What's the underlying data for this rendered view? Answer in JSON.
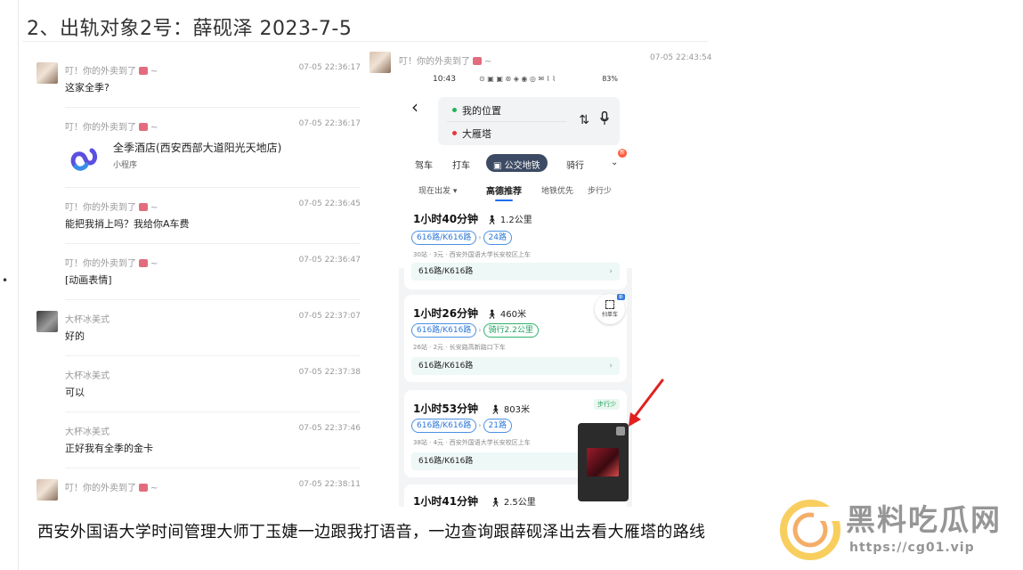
{
  "heading": "2、出轨对象2号：薛砚泽 2023-7-5",
  "bullet": "•",
  "chat": {
    "messages": [
      {
        "sender": "叮！你的外卖到了",
        "suffix": "~",
        "time": "07-05 22:36:17",
        "text": "这家全季?"
      },
      {
        "sender": "叮！你的外卖到了",
        "suffix": "~",
        "time": "07-05 22:36:17",
        "mini_program": {
          "title": "全季酒店(西安西部大道阳光天地店)",
          "sub": "小程序"
        }
      },
      {
        "sender": "叮！你的外卖到了",
        "suffix": "~",
        "time": "07-05 22:36:45",
        "text": "能把我捎上吗？我给你A车费"
      },
      {
        "sender": "叮！你的外卖到了",
        "suffix": "~",
        "time": "07-05 22:36:47",
        "text": "[动画表情]"
      },
      {
        "sender": "大杯冰美式",
        "time": "07-05 22:37:07",
        "text": "好的"
      },
      {
        "sender": "大杯冰美式",
        "time": "07-05 22:37:38",
        "text": "可以"
      },
      {
        "sender": "大杯冰美式",
        "time": "07-05 22:37:46",
        "text": "正好我有全季的金卡"
      },
      {
        "sender": "叮！你的外卖到了",
        "suffix": "~",
        "time": "07-05 22:38:11",
        "text": ""
      }
    ]
  },
  "right_header": {
    "sender": "叮！你的外卖到了",
    "suffix": "~",
    "time": "07-05 22:43:54"
  },
  "phone": {
    "clock": "10:43",
    "status_icons": "⊙ ▣ ▣ ⊛ ◈ ◉ ◎ ✉ ⌇ ⌇ ",
    "battery": "83%",
    "from": "我的位置",
    "to": "大雁塔",
    "swap_icon": "⇅",
    "modes": [
      "驾车",
      "打车",
      "公交地铁",
      "骑行"
    ],
    "mode_badge": "新",
    "filters": [
      "现在出发 ▾",
      "高德推荐",
      "地铁优先",
      "步行少"
    ],
    "scan_label": "扫单车",
    "scan_new": "新",
    "routes": [
      {
        "duration": "1小时40分钟",
        "walk": "1.2公里",
        "chips": [
          "616路/K616路",
          "24路"
        ],
        "info": "30站 · 3元 · 西安外国语大学长安校区上车",
        "line": "616路/K616路",
        "tag": ""
      },
      {
        "duration": "1小时26分钟",
        "walk": "460米",
        "chips": [
          "616路/K616路",
          "骑行2.2公里"
        ],
        "info": "26站 · 2元 · 长安路高新路口下车",
        "line": "616路/K616路",
        "tag": ""
      },
      {
        "duration": "1小时53分钟",
        "walk": "803米",
        "chips": [
          "616路/K616路",
          "21路"
        ],
        "info": "38站 · 4元 · 西安外国语大学长安校区上车",
        "line": "616路/K616路",
        "tag": "步行少"
      },
      {
        "duration": "1小时41分钟",
        "walk": "2.5公里",
        "chips": [],
        "info": "",
        "line": "",
        "tag": ""
      }
    ]
  },
  "caption": "西安外国语大学时间管理大师丁玉婕一边跟我打语音，一边查询跟薛砚泽出去看大雁塔的路线",
  "watermark": {
    "title": "黑料吃瓜网",
    "url": "https://cg01.vip"
  },
  "colors": {
    "accent_blue": "#2f78d8",
    "green": "#22a15e",
    "nav_active": "#3c4a63",
    "arrow_red": "#e02020"
  }
}
